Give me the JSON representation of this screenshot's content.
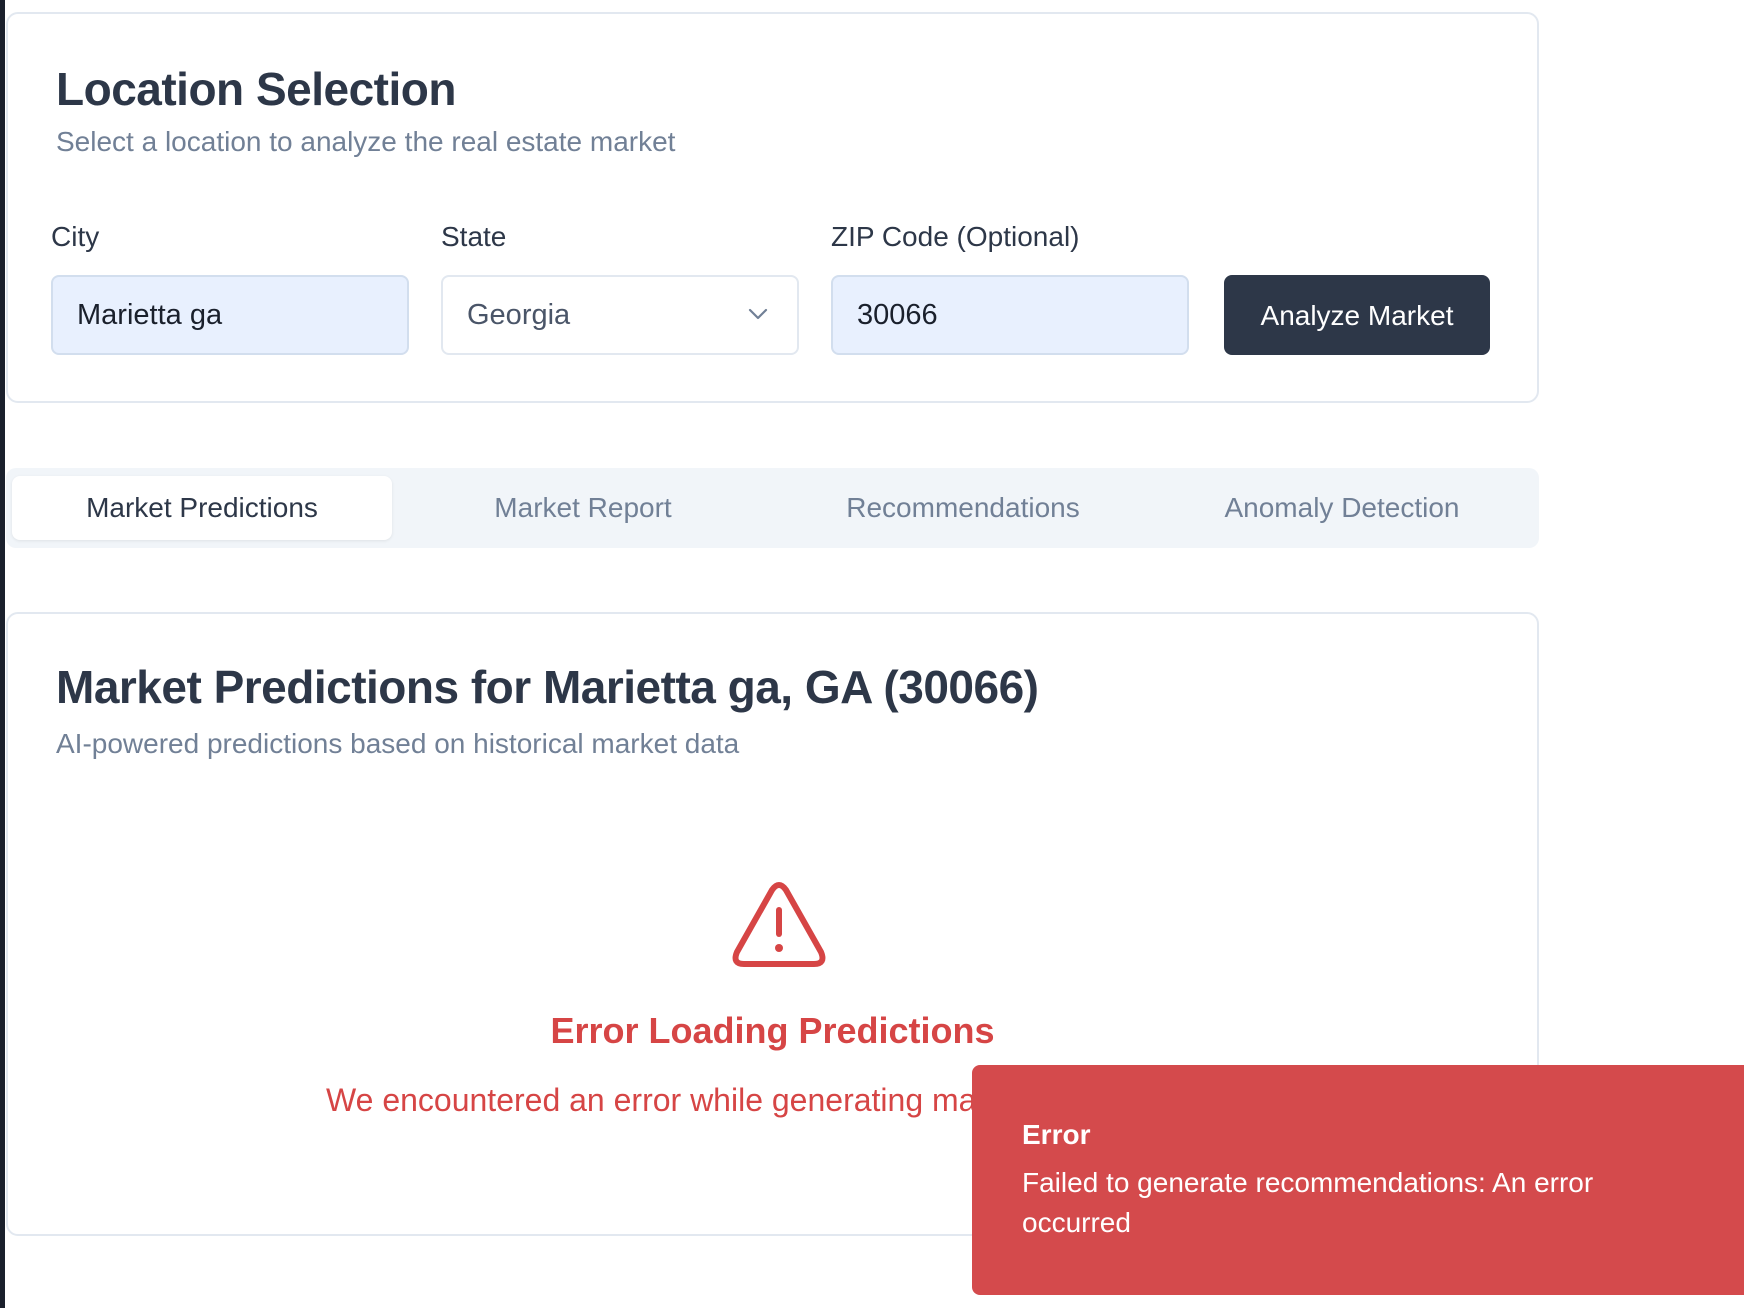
{
  "location_card": {
    "title": "Location Selection",
    "subtitle": "Select a location to analyze the real estate market",
    "city": {
      "label": "City",
      "value": "Marietta ga"
    },
    "state": {
      "label": "State",
      "value": "Georgia"
    },
    "zip": {
      "label": "ZIP Code (Optional)",
      "value": "30066"
    },
    "analyze_button": "Analyze Market"
  },
  "tabs": [
    {
      "label": "Market Predictions",
      "active": true
    },
    {
      "label": "Market Report",
      "active": false
    },
    {
      "label": "Recommendations",
      "active": false
    },
    {
      "label": "Anomaly Detection",
      "active": false
    }
  ],
  "predictions_card": {
    "title": "Market Predictions for Marietta ga, GA (30066)",
    "subtitle": "AI-powered predictions based on historical market data",
    "error_icon": "alert-triangle-icon",
    "error_title": "Error Loading Predictions",
    "error_message": "We encountered an error while generating ma"
  },
  "toast": {
    "title": "Error",
    "message": "Failed to generate recommendations: An error occurred"
  },
  "colors": {
    "primary_dark": "#2d3748",
    "error_red": "#d64545",
    "toast_bg": "#d44a4c",
    "input_autofill_bg": "#e8f0fe",
    "tabs_bg": "#f1f5f9"
  }
}
